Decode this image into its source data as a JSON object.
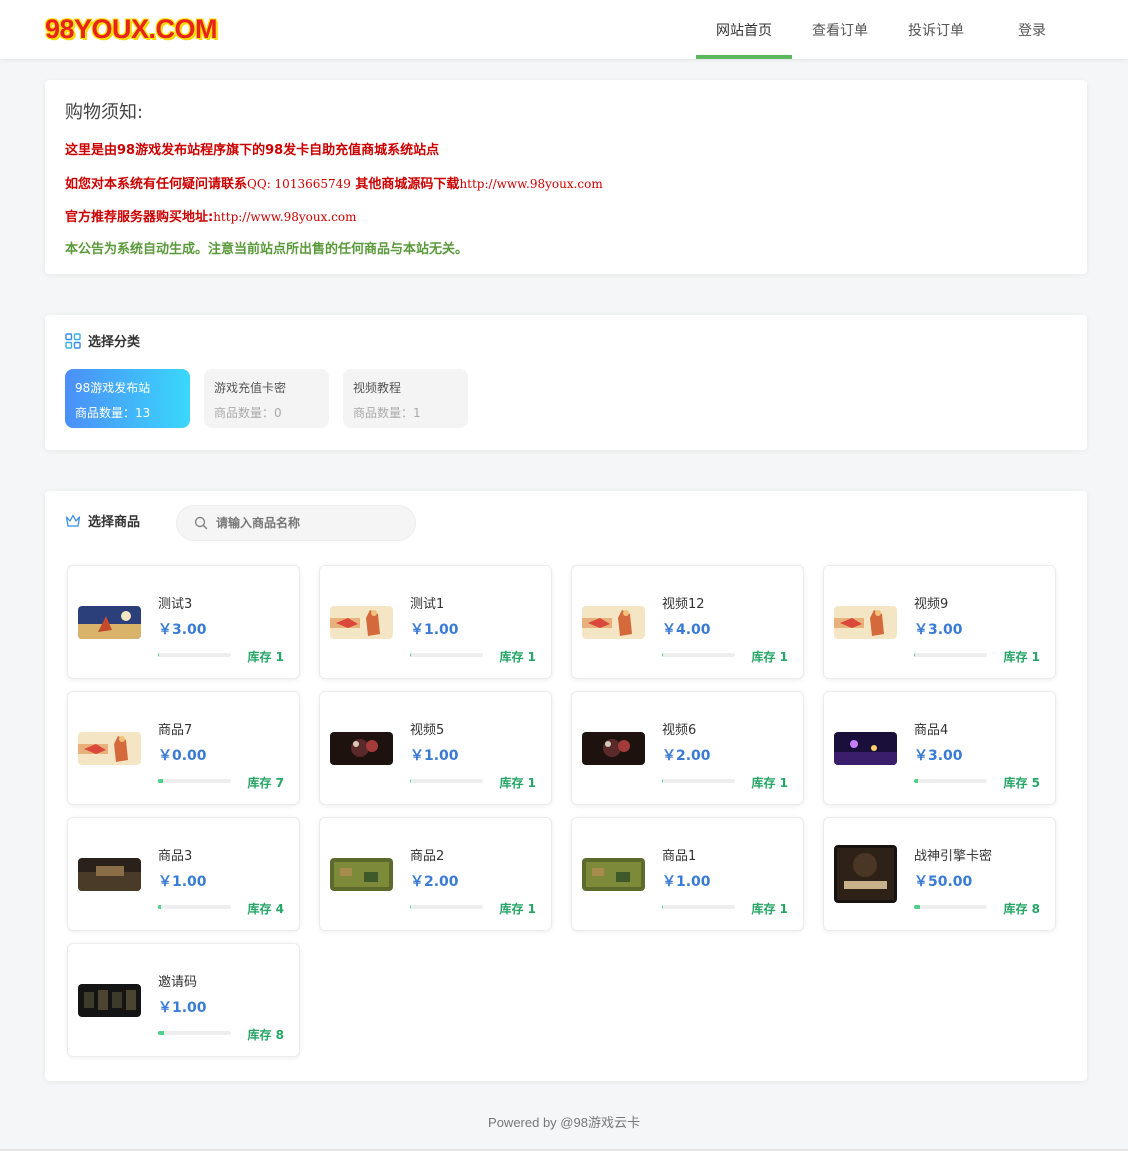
{
  "header": {
    "logo": "98YOUX.COM",
    "nav": [
      {
        "label": "网站首页",
        "active": true
      },
      {
        "label": "查看订单",
        "active": false
      },
      {
        "label": "投诉订单",
        "active": false
      },
      {
        "label": "登录",
        "active": false
      }
    ]
  },
  "notice": {
    "title": "购物须知:",
    "line1": "这里是由98游戏发布站程序旗下的98发卡自助充值商城系统站点",
    "line2_a": "如您对本系统有任何疑问请联系",
    "line2_b": "QQ: 1013665749",
    "line2_c": " 其他商城源码下载",
    "line2_d": "http://www.98youx.com",
    "line3_a": "官方推荐服务器购买地址:",
    "line3_b": "http://www.98youx.com",
    "line4": "本公告为系统自动生成。注意当前站点所出售的任何商品与本站无关。"
  },
  "category": {
    "title": "选择分类",
    "items": [
      {
        "name": "98游戏发布站",
        "count": "商品数量：13",
        "active": true
      },
      {
        "name": "游戏充值卡密",
        "count": "商品数量：0",
        "active": false
      },
      {
        "name": "视频教程",
        "count": "商品数量：1",
        "active": false
      }
    ]
  },
  "goods": {
    "title": "选择商品",
    "search_placeholder": "请输入商品名称",
    "items": [
      {
        "name": "测试3",
        "price": "￥3.00",
        "stock": "库存 1",
        "level": 0.01,
        "thumb": "blue"
      },
      {
        "name": "测试1",
        "price": "￥1.00",
        "stock": "库存 1",
        "level": 0.01,
        "thumb": "cream"
      },
      {
        "name": "视频12",
        "price": "￥4.00",
        "stock": "库存 1",
        "level": 0.01,
        "thumb": "cream"
      },
      {
        "name": "视频9",
        "price": "￥3.00",
        "stock": "库存 1",
        "level": 0.01,
        "thumb": "cream"
      },
      {
        "name": "商品7",
        "price": "￥0.00",
        "stock": "库存 7",
        "level": 0.07,
        "thumb": "cream"
      },
      {
        "name": "视频5",
        "price": "￥1.00",
        "stock": "库存 1",
        "level": 0.01,
        "thumb": "dark"
      },
      {
        "name": "视频6",
        "price": "￥2.00",
        "stock": "库存 1",
        "level": 0.01,
        "thumb": "dark"
      },
      {
        "name": "商品4",
        "price": "￥3.00",
        "stock": "库存 5",
        "level": 0.05,
        "thumb": "purple"
      },
      {
        "name": "商品3",
        "price": "￥1.00",
        "stock": "库存 4",
        "level": 0.04,
        "thumb": "brown"
      },
      {
        "name": "商品2",
        "price": "￥2.00",
        "stock": "库存 1",
        "level": 0.01,
        "thumb": "green"
      },
      {
        "name": "商品1",
        "price": "￥1.00",
        "stock": "库存 1",
        "level": 0.01,
        "thumb": "green"
      },
      {
        "name": "战神引擎卡密",
        "price": "￥50.00",
        "stock": "库存 8",
        "level": 0.08,
        "thumb": "poster"
      },
      {
        "name": "邀请码",
        "price": "￥1.00",
        "stock": "库存 8",
        "level": 0.08,
        "thumb": "darkgrid"
      }
    ]
  },
  "footer": "Powered by @98游戏云卡"
}
